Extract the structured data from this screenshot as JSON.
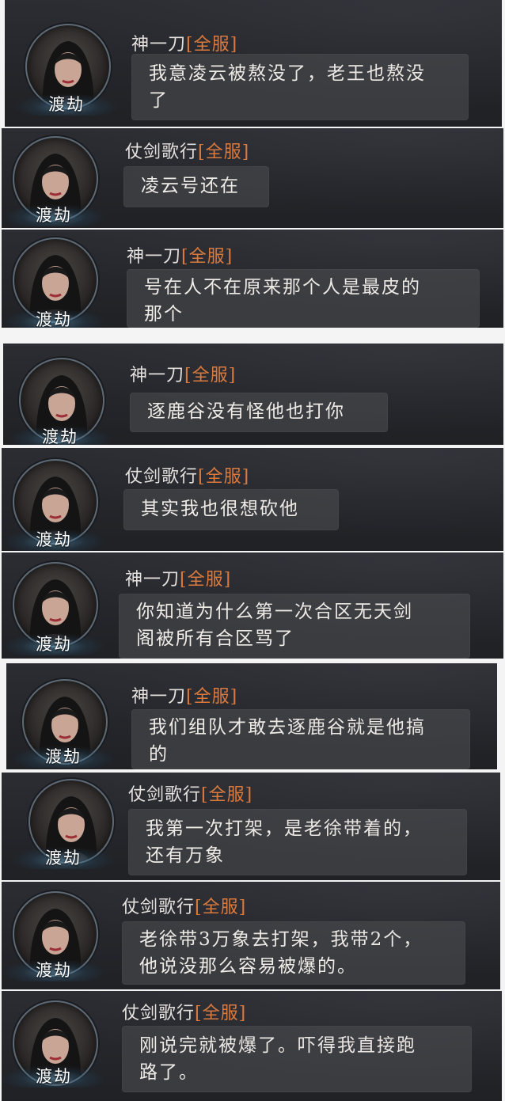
{
  "server_tag": "[全服]",
  "avatar_label": "渡劫",
  "messages": [
    {
      "sender": "神一刀",
      "lines": [
        "我意凌云被熬没了，老王也熬没",
        "了"
      ]
    },
    {
      "sender": "仗剑歌行",
      "lines": [
        "凌云号还在"
      ]
    },
    {
      "sender": "神一刀",
      "lines": [
        "号在人不在原来那个人是最皮的",
        "那个"
      ]
    },
    {
      "sender": "神一刀",
      "lines": [
        "逐鹿谷没有怪他也打你"
      ]
    },
    {
      "sender": "仗剑歌行",
      "lines": [
        "其实我也很想砍他"
      ]
    },
    {
      "sender": "神一刀",
      "lines": [
        "你知道为什么第一次合区无天剑",
        "阁被所有合区骂了"
      ]
    },
    {
      "sender": "神一刀",
      "lines": [
        "我们组队才敢去逐鹿谷就是他搞",
        "的"
      ]
    },
    {
      "sender": "仗剑歌行",
      "lines": [
        "我第一次打架，是老徐带着的，",
        "还有万象"
      ]
    },
    {
      "sender": "仗剑歌行",
      "lines": [
        "老徐带3万象去打架，我带2个，",
        "他说没那么容易被爆的。"
      ]
    },
    {
      "sender": "仗剑歌行",
      "lines": [
        "刚说完就被爆了。吓得我直接跑",
        "路了。"
      ]
    }
  ]
}
